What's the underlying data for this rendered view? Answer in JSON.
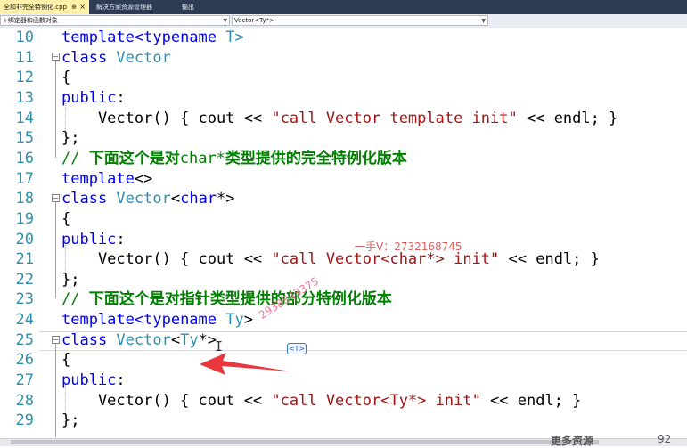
{
  "tabs": [
    {
      "label": "全和非完全特例化.cpp",
      "active": true
    },
    {
      "label": "解决方案资源管理器",
      "active": false
    },
    {
      "label": "输出",
      "active": false
    }
  ],
  "tab_pin_glyph": "⊕",
  "tab_close_glyph": "×",
  "navigation": {
    "scope_label": "(全局范围)",
    "scope_short": "+绑定器和函数对象",
    "member_label": "Vector<Ty*>"
  },
  "code_lines": [
    {
      "num": "10",
      "segments": [
        {
          "text": "template<",
          "cls": "k"
        },
        {
          "text": "typename",
          "cls": "k"
        },
        {
          "text": " T>",
          "cls": "t"
        }
      ]
    },
    {
      "num": "11",
      "segments": [
        {
          "text": "class",
          "cls": "k"
        },
        {
          "text": " Vector",
          "cls": "t"
        }
      ]
    },
    {
      "num": "12",
      "segments": [
        {
          "text": "{",
          "cls": ""
        }
      ]
    },
    {
      "num": "13",
      "segments": [
        {
          "text": "public",
          "cls": "k"
        },
        {
          "text": ":",
          "cls": ""
        }
      ]
    },
    {
      "num": "14",
      "segments": [
        {
          "text": "    Vector() { cout << ",
          "cls": ""
        },
        {
          "text": "\"call Vector template init\"",
          "cls": "s"
        },
        {
          "text": " << endl; }",
          "cls": ""
        }
      ]
    },
    {
      "num": "15",
      "segments": [
        {
          "text": "};",
          "cls": ""
        }
      ]
    },
    {
      "num": "16",
      "segments": [
        {
          "text": "// ",
          "cls": "c"
        },
        {
          "text": "下面这个是对",
          "cls": "cz"
        },
        {
          "text": "char*",
          "cls": "c"
        },
        {
          "text": "类型提供的完全特例化版本",
          "cls": "cz"
        }
      ]
    },
    {
      "num": "17",
      "segments": [
        {
          "text": "template",
          "cls": "k"
        },
        {
          "text": "<>",
          "cls": ""
        }
      ]
    },
    {
      "num": "18",
      "segments": [
        {
          "text": "class",
          "cls": "k"
        },
        {
          "text": " Vector",
          "cls": "t"
        },
        {
          "text": "<",
          "cls": ""
        },
        {
          "text": "char",
          "cls": "k"
        },
        {
          "text": "*>",
          "cls": ""
        }
      ]
    },
    {
      "num": "19",
      "segments": [
        {
          "text": "{",
          "cls": ""
        }
      ]
    },
    {
      "num": "20",
      "segments": [
        {
          "text": "public",
          "cls": "k"
        },
        {
          "text": ":",
          "cls": ""
        }
      ]
    },
    {
      "num": "21",
      "segments": [
        {
          "text": "    Vector() { cout << ",
          "cls": ""
        },
        {
          "text": "\"call Vector<char*> init\"",
          "cls": "s"
        },
        {
          "text": " << endl; }",
          "cls": ""
        }
      ]
    },
    {
      "num": "22",
      "segments": [
        {
          "text": "};",
          "cls": ""
        }
      ]
    },
    {
      "num": "23",
      "segments": [
        {
          "text": "// ",
          "cls": "c"
        },
        {
          "text": "下面这个是对指针类型提供的部分特例化版本",
          "cls": "cz"
        }
      ]
    },
    {
      "num": "24",
      "segments": [
        {
          "text": "template<",
          "cls": "k"
        },
        {
          "text": "typename",
          "cls": "k"
        },
        {
          "text": " Ty",
          "cls": "t"
        },
        {
          "text": ">",
          "cls": ""
        }
      ]
    },
    {
      "num": "25",
      "segments": [
        {
          "text": "class",
          "cls": "k"
        },
        {
          "text": " Vector",
          "cls": "t"
        },
        {
          "text": "<",
          "cls": ""
        },
        {
          "text": "Ty",
          "cls": "t"
        },
        {
          "text": "*>",
          "cls": ""
        }
      ]
    },
    {
      "num": "26",
      "segments": [
        {
          "text": "{",
          "cls": ""
        }
      ]
    },
    {
      "num": "27",
      "segments": [
        {
          "text": "public",
          "cls": "k"
        },
        {
          "text": ":",
          "cls": ""
        }
      ]
    },
    {
      "num": "28",
      "segments": [
        {
          "text": "    Vector() { cout << ",
          "cls": ""
        },
        {
          "text": "\"call Vector<Ty*> init\"",
          "cls": "s"
        },
        {
          "text": " << endl; }",
          "cls": ""
        }
      ]
    },
    {
      "num": "29",
      "segments": [
        {
          "text": "};",
          "cls": ""
        }
      ]
    }
  ],
  "template_badge": "<T>",
  "watermark_contact": "一手V：2732168745",
  "watermark_diagonal": "2938843375",
  "bottom_partial_text": "更多资源",
  "bottom_partial_num": "92",
  "colors": {
    "keyword": "#0000ff",
    "type": "#2b91af",
    "string": "#a31515",
    "comment": "#008000",
    "arrow": "#e8383d",
    "tab_active": "#fff1a8"
  }
}
